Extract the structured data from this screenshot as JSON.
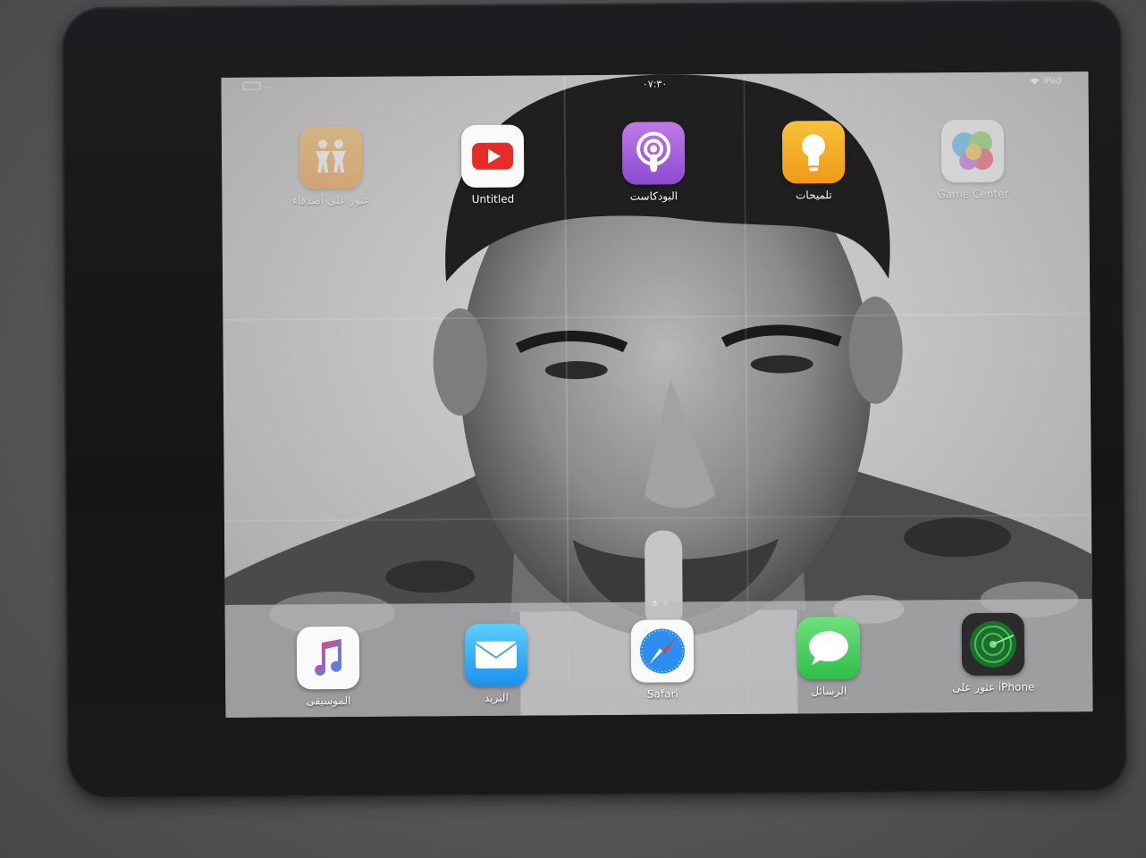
{
  "status_bar": {
    "left_text": "…",
    "time": "٠٧:٣٠",
    "right_text": "iPad"
  },
  "home_apps": [
    {
      "name": "find-friends",
      "label": "عثور على أصدقاء",
      "icon": "people-icon",
      "color": "#f29a2e"
    },
    {
      "name": "untitled",
      "label": "Untitled",
      "icon": "youtube-play-icon",
      "color": "#ffffff"
    },
    {
      "name": "podcasts",
      "label": "البودكاست",
      "icon": "podcast-icon",
      "color": "#9a5bd3"
    },
    {
      "name": "tips",
      "label": "تلميحات",
      "icon": "lightbulb-icon",
      "color": "#f2a51f"
    },
    {
      "name": "game-center",
      "label": "Game Center",
      "icon": "bubbles-icon",
      "color": "#f0f0f0"
    }
  ],
  "dock_apps": [
    {
      "name": "music",
      "label": "الموسيقى",
      "icon": "music-note-icon",
      "color": "#ffffff"
    },
    {
      "name": "mail",
      "label": "البريد",
      "icon": "envelope-icon",
      "color": "#27a9f0"
    },
    {
      "name": "safari",
      "label": "Safari",
      "icon": "compass-icon",
      "color": "#ffffff"
    },
    {
      "name": "messages",
      "label": "الرسائل",
      "icon": "speech-bubble-icon",
      "color": "#4cd263"
    },
    {
      "name": "find-iphone",
      "label": "عثور على iPhone",
      "icon": "radar-icon",
      "color": "#2a2a2a"
    }
  ],
  "page_indicator": {
    "pages": 2,
    "current": 1
  }
}
